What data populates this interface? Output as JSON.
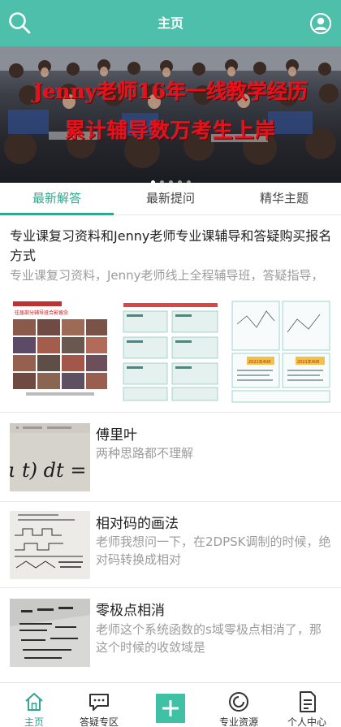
{
  "header": {
    "title": "主页"
  },
  "banner": {
    "line1": "Jenny老师16年一线教学经历",
    "line2": "累计辅导数万考生上岸",
    "slide_count": 5,
    "active_slide": 0
  },
  "tabs": [
    {
      "label": "最新解答",
      "active": true
    },
    {
      "label": "最新提问",
      "active": false
    },
    {
      "label": "精华主题",
      "active": false
    }
  ],
  "featured": {
    "title": "专业课复习资料和Jenny老师专业课辅导和答疑购买报名方式",
    "summary": "专业课复习资料，Jenny老师线上全程辅导班，答疑指导，",
    "thumb1_caption": "往届部分辅导班合影留念",
    "thumb3_badges": [
      "2021年408",
      "2021年408"
    ]
  },
  "posts": [
    {
      "title": "傅里叶",
      "summary": "两种思路都不理解",
      "thumb_text": "ι t) dt ="
    },
    {
      "title": "相对码的画法",
      "summary": "老师我想问一下，在2DPSK调制的时候，绝对码转换成相对"
    },
    {
      "title": "零极点相消",
      "summary": "老师这个系统函数的s域零极点相消了，那这个时候的收敛域是"
    }
  ],
  "nav": [
    {
      "label": "主页",
      "icon": "home-icon",
      "active": true
    },
    {
      "label": "答疑专区",
      "icon": "chat-icon",
      "active": false
    },
    {
      "label": "",
      "icon": "plus-icon",
      "active": false
    },
    {
      "label": "专业资源",
      "icon": "resource-icon",
      "active": false
    },
    {
      "label": "个人中心",
      "icon": "document-icon",
      "active": false
    }
  ],
  "colors": {
    "brand": "#4dbfab",
    "accent": "#33a68f",
    "banner_text": "#e8101a",
    "plus": "#3fc1a5"
  }
}
